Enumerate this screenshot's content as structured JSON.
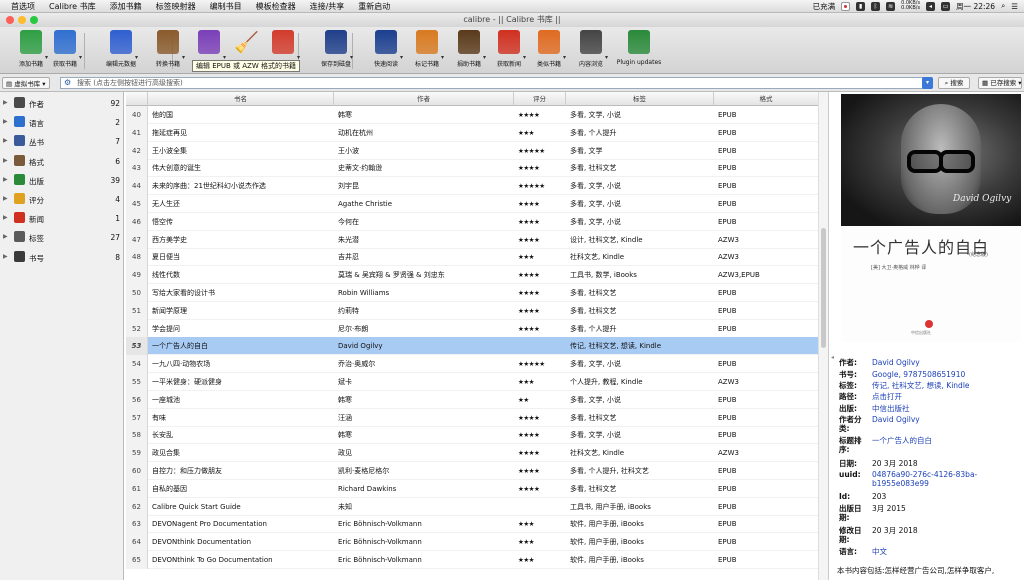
{
  "menubar": {
    "items": [
      "首选项",
      "Calibre 书库",
      "添加书籍",
      "标签映射器",
      "编制书目",
      "模板检查器",
      "连接/共享",
      "重新启动"
    ],
    "status": {
      "charge": "已充满",
      "net_up": "0.0KB/s",
      "net_down": "0.0KB/s",
      "time": "周一 22:26"
    }
  },
  "window": {
    "title": "calibre - || Calibre 书库 ||"
  },
  "toolbar": {
    "buttons": [
      {
        "label": "添加书籍",
        "icon": "add-book-icon",
        "color": "#2f9e44"
      },
      {
        "label": "获取书籍",
        "icon": "get-books-icon",
        "color": "#2f6fd0"
      },
      {
        "label": "编辑元数据",
        "icon": "edit-metadata-icon",
        "color": "#2f5fd0"
      },
      {
        "label": "转换书籍",
        "icon": "convert-books-icon",
        "color": "#8a5a2b"
      },
      {
        "label": "编辑书籍",
        "icon": "edit-book-icon",
        "color": "#7a3fb8"
      },
      {
        "label": "",
        "icon": "broom-icon",
        "color": "#e0b020"
      },
      {
        "label": "删除书籍",
        "icon": "remove-books-icon",
        "color": "#d23c2c"
      },
      {
        "label": "保存到磁盘",
        "icon": "save-to-disk-icon",
        "color": "#1f3f8a"
      },
      {
        "label": "快速阅读",
        "icon": "view-icon",
        "color": "#1b3f8f"
      },
      {
        "label": "标记书籍",
        "icon": "mark-books-icon",
        "color": "#d87a20"
      },
      {
        "label": "捐助书籍",
        "icon": "donate-icon",
        "color": "#5a3a1a"
      },
      {
        "label": "获取新闻",
        "icon": "fetch-news-icon",
        "color": "#d03020"
      },
      {
        "label": "类似书籍",
        "icon": "similar-books-icon",
        "color": "#e06a20"
      },
      {
        "label": "内容浏览",
        "icon": "browse-icon",
        "color": "#444444"
      },
      {
        "label": "Plugin updates",
        "icon": "plugin-updates-icon",
        "color": "#2a8a3a"
      }
    ],
    "tooltip": "编辑 EPUB 或 AZW 格式的书籍"
  },
  "search": {
    "virtual_library": "虚拟书库",
    "placeholder": "搜索 (点击左侧按钮进行高级搜索)",
    "search_button": "搜索",
    "saved_button": "已存搜索"
  },
  "tag_browser": {
    "categories": [
      {
        "name": "作者",
        "count": "92",
        "icon": "authors-icon",
        "color": "#4a4a4a"
      },
      {
        "name": "语言",
        "count": "2",
        "icon": "languages-icon",
        "color": "#2c6fcf"
      },
      {
        "name": "丛书",
        "count": "7",
        "icon": "series-icon",
        "color": "#3a5a9a"
      },
      {
        "name": "格式",
        "count": "6",
        "icon": "formats-icon",
        "color": "#7a5a3a"
      },
      {
        "name": "出版",
        "count": "39",
        "icon": "publisher-icon",
        "color": "#2a8a3a"
      },
      {
        "name": "评分",
        "count": "4",
        "icon": "rating-icon",
        "color": "#e0a020"
      },
      {
        "name": "新闻",
        "count": "1",
        "icon": "news-icon",
        "color": "#d03020"
      },
      {
        "name": "标签",
        "count": "27",
        "icon": "tags-icon",
        "color": "#5a5a5a"
      },
      {
        "name": "书号",
        "count": "8",
        "icon": "identifiers-icon",
        "color": "#3a3a3a"
      }
    ]
  },
  "book_list": {
    "columns": [
      "书名",
      "作者",
      "评分",
      "标签",
      "格式"
    ],
    "rows": [
      {
        "num": "40",
        "title": "他的国",
        "author": "韩寒",
        "rating": "★★★★",
        "tags": "多看, 文学, 小说",
        "format": "EPUB"
      },
      {
        "num": "41",
        "title": "拖延症再见",
        "author": "动机在杭州",
        "rating": "★★★",
        "tags": "多看, 个人提升",
        "format": "EPUB"
      },
      {
        "num": "42",
        "title": "王小波全集",
        "author": "王小波",
        "rating": "★★★★★",
        "tags": "多看, 文学",
        "format": "EPUB"
      },
      {
        "num": "43",
        "title": "伟大创意的诞生",
        "author": "史蒂文·约翰逊",
        "rating": "★★★★",
        "tags": "多看, 社科文艺",
        "format": "EPUB"
      },
      {
        "num": "44",
        "title": "未来的序曲：21世纪科幻小说杰作选",
        "author": "刘宇昆",
        "rating": "★★★★★",
        "tags": "多看, 文学, 小说",
        "format": "EPUB"
      },
      {
        "num": "45",
        "title": "无人生还",
        "author": "Agathe Christie",
        "rating": "★★★★",
        "tags": "多看, 文学, 小说",
        "format": "EPUB"
      },
      {
        "num": "46",
        "title": "悟空传",
        "author": "今何在",
        "rating": "★★★★",
        "tags": "多看, 文学, 小说",
        "format": "EPUB"
      },
      {
        "num": "47",
        "title": "西方美学史",
        "author": "朱光潜",
        "rating": "★★★★",
        "tags": "设计, 社科文艺, Kindle",
        "format": "AZW3"
      },
      {
        "num": "48",
        "title": "夏日便当",
        "author": "吉井忍",
        "rating": "★★★",
        "tags": "社科文艺, Kindle",
        "format": "AZW3"
      },
      {
        "num": "49",
        "title": "线性代数",
        "author": "莫瑞 & 吴宾翔 & 罗贤强 & 刘忠东",
        "rating": "★★★★",
        "tags": "工具书, 数学, iBooks",
        "format": "AZW3,EPUB"
      },
      {
        "num": "50",
        "title": "写给大家看的设计书",
        "author": "Robin Williams",
        "rating": "★★★★",
        "tags": "多看, 社科文艺",
        "format": "EPUB"
      },
      {
        "num": "51",
        "title": "新闻学原理",
        "author": "约莉特",
        "rating": "★★★★",
        "tags": "多看, 社科文艺",
        "format": "EPUB"
      },
      {
        "num": "52",
        "title": "学会提问",
        "author": "尼尔·布朗",
        "rating": "★★★★",
        "tags": "多看, 个人提升",
        "format": "EPUB"
      },
      {
        "num": "53",
        "title": "一个广告人的自白",
        "author": "David Ogilvy",
        "rating": "",
        "tags": "传记, 社科文艺, 想读, Kindle",
        "format": "",
        "selected": true
      },
      {
        "num": "54",
        "title": "一九八四·动物农场",
        "author": "乔治·奥威尔",
        "rating": "★★★★★",
        "tags": "多看, 文学, 小说",
        "format": "EPUB"
      },
      {
        "num": "55",
        "title": "一平米健身：硬派健身",
        "author": "斌卡",
        "rating": "★★★",
        "tags": "个人提升, 教程, Kindle",
        "format": "AZW3"
      },
      {
        "num": "56",
        "title": "一座城池",
        "author": "韩寒",
        "rating": "★★",
        "tags": "多看, 文学, 小说",
        "format": "EPUB"
      },
      {
        "num": "57",
        "title": "有味",
        "author": "汪涵",
        "rating": "★★★★",
        "tags": "多看, 社科文艺",
        "format": "EPUB"
      },
      {
        "num": "58",
        "title": "长安乱",
        "author": "韩寒",
        "rating": "★★★★",
        "tags": "多看, 文学, 小说",
        "format": "EPUB"
      },
      {
        "num": "59",
        "title": "政见合集",
        "author": "政见",
        "rating": "★★★★",
        "tags": "社科文艺, Kindle",
        "format": "AZW3"
      },
      {
        "num": "60",
        "title": "自控力：和压力做朋友",
        "author": "凯利·麦格尼格尔",
        "rating": "★★★★",
        "tags": "多看, 个人提升, 社科文艺",
        "format": "EPUB"
      },
      {
        "num": "61",
        "title": "自私的基因",
        "author": "Richard Dawkins",
        "rating": "★★★★",
        "tags": "多看, 社科文艺",
        "format": "EPUB"
      },
      {
        "num": "62",
        "title": "Calibre Quick Start Guide",
        "author": "未知",
        "rating": "",
        "tags": "工具书, 用户手册, iBooks",
        "format": "EPUB"
      },
      {
        "num": "63",
        "title": "DEVONagent Pro Documentation",
        "author": "Eric Böhnisch-Volkmann",
        "rating": "★★★",
        "tags": "软件, 用户手册, iBooks",
        "format": "EPUB"
      },
      {
        "num": "64",
        "title": "DEVONthink Documentation",
        "author": "Eric Böhnisch-Volkmann",
        "rating": "★★★",
        "tags": "软件, 用户手册, iBooks",
        "format": "EPUB"
      },
      {
        "num": "65",
        "title": "DEVONthink To Go Documentation",
        "author": "Eric Böhnisch-Volkmann",
        "rating": "★★★",
        "tags": "软件, 用户手册, iBooks",
        "format": "EPUB"
      }
    ]
  },
  "details": {
    "cover": {
      "title": "一个广告人的自白",
      "edition": "(纪念版)",
      "author_line": "[美] 大卫·奥格威  林桦 译",
      "signature": "David Ogilvy",
      "publisher": "中信出版社"
    },
    "fields": [
      {
        "key": "作者:",
        "value": "David Ogilvy",
        "link": true
      },
      {
        "key": "书号:",
        "value": "Google, 9787508651910",
        "link": true
      },
      {
        "key": "标签:",
        "value": "传记, 社科文艺, 想读, Kindle",
        "link": true
      },
      {
        "key": "路径:",
        "value": "点击打开",
        "link": true
      },
      {
        "key": "出版:",
        "value": "中信出版社",
        "link": true
      },
      {
        "key": "作者分类:",
        "value": "David Ogilvy",
        "link": true
      },
      {
        "key": "标题排序:",
        "value": "一个广告人的自白",
        "link": true
      },
      {
        "key": "日期:",
        "value": "20 3月 2018",
        "link": false
      },
      {
        "key": "uuid:",
        "value": "04876a90-276c-4126-83ba-b1955e083e99",
        "link": true
      },
      {
        "key": "Id:",
        "value": "203",
        "link": false
      },
      {
        "key": "出版日期:",
        "value": "3月 2015",
        "link": false
      },
      {
        "key": "修改日期:",
        "value": "20 3月 2018",
        "link": false
      },
      {
        "key": "语言:",
        "value": "中文",
        "link": true
      }
    ],
    "comments": "本书内容包括:怎样经营广告公司,怎样争取客户,"
  }
}
